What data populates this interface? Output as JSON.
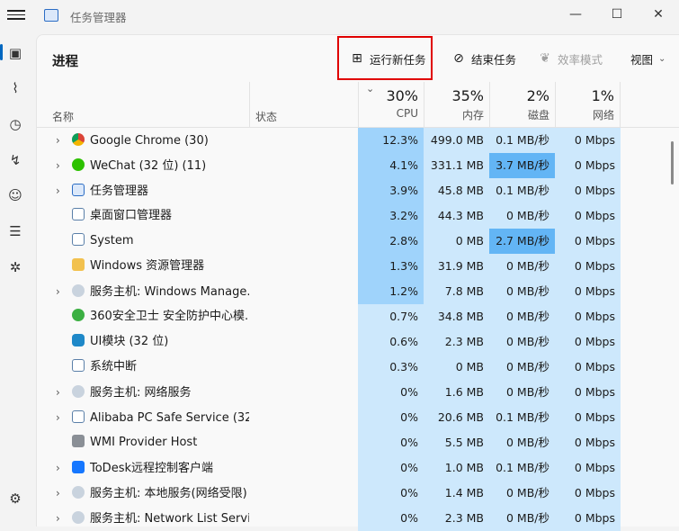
{
  "app": {
    "title": "任务管理器",
    "minimize": "—",
    "maximize": "☐",
    "close": "✕"
  },
  "sidebar": {
    "icons": [
      "processes-icon",
      "performance-icon",
      "app-history-icon",
      "startup-apps-icon",
      "users-icon",
      "details-icon",
      "services-icon"
    ],
    "settings_icon": "gear-icon"
  },
  "toolbar": {
    "page_title": "进程",
    "run_new_task": "运行新任务",
    "end_task": "结束任务",
    "efficiency_mode": "效率模式",
    "view": "视图"
  },
  "columns": {
    "name": "名称",
    "status": "状态",
    "cpu": {
      "pct": "30%",
      "label": "CPU"
    },
    "memory": {
      "pct": "35%",
      "label": "内存"
    },
    "disk": {
      "pct": "2%",
      "label": "磁盘"
    },
    "network": {
      "pct": "1%",
      "label": "网络"
    }
  },
  "colors": {
    "heat_high": "#9fd3fb",
    "heat_low": "#cde8fc",
    "heat_mid": "#b7ddfb",
    "disk_hot": "#63b5f5",
    "highlight": "#e00000",
    "accent": "#0067c0"
  },
  "processes": [
    {
      "name": "Google Chrome (30)",
      "expand": true,
      "icon": "chrome-icon",
      "cpu": "12.3%",
      "mem": "499.0 MB",
      "disk": "0.1 MB/秒",
      "net": "0 Mbps"
    },
    {
      "name": "WeChat (32 位) (11)",
      "expand": true,
      "icon": "wechat-icon",
      "cpu": "4.1%",
      "mem": "331.1 MB",
      "disk": "3.7 MB/秒",
      "net": "0 Mbps"
    },
    {
      "name": "任务管理器",
      "expand": true,
      "icon": "task-manager-icon",
      "cpu": "3.9%",
      "mem": "45.8 MB",
      "disk": "0.1 MB/秒",
      "net": "0 Mbps"
    },
    {
      "name": "桌面窗口管理器",
      "expand": false,
      "icon": "window-icon",
      "cpu": "3.2%",
      "mem": "44.3 MB",
      "disk": "0 MB/秒",
      "net": "0 Mbps"
    },
    {
      "name": "System",
      "expand": false,
      "icon": "window-icon",
      "cpu": "2.8%",
      "mem": "0 MB",
      "disk": "2.7 MB/秒",
      "net": "0 Mbps"
    },
    {
      "name": "Windows 资源管理器",
      "expand": false,
      "icon": "folder-icon",
      "cpu": "1.3%",
      "mem": "31.9 MB",
      "disk": "0 MB/秒",
      "net": "0 Mbps"
    },
    {
      "name": "服务主机: Windows Manage...",
      "expand": true,
      "icon": "service-gear-icon",
      "cpu": "1.2%",
      "mem": "7.8 MB",
      "disk": "0 MB/秒",
      "net": "0 Mbps"
    },
    {
      "name": "360安全卫士 安全防护中心模...",
      "expand": false,
      "icon": "shield-360-icon",
      "cpu": "0.7%",
      "mem": "34.8 MB",
      "disk": "0 MB/秒",
      "net": "0 Mbps"
    },
    {
      "name": "UI模块 (32 位)",
      "expand": false,
      "icon": "hexagon-icon",
      "cpu": "0.6%",
      "mem": "2.3 MB",
      "disk": "0 MB/秒",
      "net": "0 Mbps"
    },
    {
      "name": "系统中断",
      "expand": false,
      "icon": "window-icon",
      "cpu": "0.3%",
      "mem": "0 MB",
      "disk": "0 MB/秒",
      "net": "0 Mbps"
    },
    {
      "name": "服务主机: 网络服务",
      "expand": true,
      "icon": "service-gear-icon",
      "cpu": "0%",
      "mem": "1.6 MB",
      "disk": "0 MB/秒",
      "net": "0 Mbps"
    },
    {
      "name": "Alibaba PC Safe Service (32...",
      "expand": true,
      "icon": "window-icon",
      "cpu": "0%",
      "mem": "20.6 MB",
      "disk": "0.1 MB/秒",
      "net": "0 Mbps"
    },
    {
      "name": "WMI Provider Host",
      "expand": false,
      "icon": "wmi-icon",
      "cpu": "0%",
      "mem": "5.5 MB",
      "disk": "0 MB/秒",
      "net": "0 Mbps"
    },
    {
      "name": "ToDesk远程控制客户端",
      "expand": true,
      "icon": "todesk-icon",
      "cpu": "0%",
      "mem": "1.0 MB",
      "disk": "0.1 MB/秒",
      "net": "0 Mbps"
    },
    {
      "name": "服务主机: 本地服务(网络受限)",
      "expand": true,
      "icon": "service-gear-icon",
      "cpu": "0%",
      "mem": "1.4 MB",
      "disk": "0 MB/秒",
      "net": "0 Mbps"
    },
    {
      "name": "服务主机: Network List Servi...",
      "expand": true,
      "icon": "service-gear-icon",
      "cpu": "0%",
      "mem": "2.3 MB",
      "disk": "0 MB/秒",
      "net": "0 Mbps"
    }
  ]
}
